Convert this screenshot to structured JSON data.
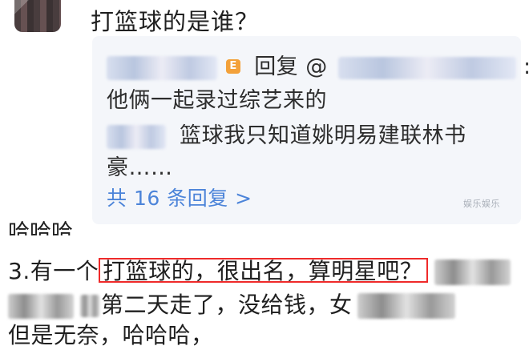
{
  "window": {
    "title": ""
  },
  "top_comment": {
    "question": "打篮球的是谁？"
  },
  "reply_card": {
    "reply_prefix_badge": "E",
    "reply_label": "回复",
    "reply_at": "@",
    "reply_colon": ":",
    "reply_text_1": "他俩一起录过综艺来的",
    "reply_text_2": "篮球我只知道姚明易建联林书",
    "reply_text_3": "豪……",
    "reply_count_text": "共 16 条回复 >",
    "colors": {
      "link": "#4c84d9",
      "background": "#f4f6fa"
    }
  },
  "watermark": {
    "text": "娱乐娱乐"
  },
  "main_text": {
    "cropped_prev": "哈哈哈",
    "item_prefix": "3.有一个",
    "highlighted": "打篮球的，很出名，算明星吧？",
    "line2_tail": "第二天走了，没给钱，",
    "line2_end": "女",
    "line3": "但是无奈，哈哈哈，"
  },
  "icons": {
    "reply_badge": "badge-e-icon"
  }
}
